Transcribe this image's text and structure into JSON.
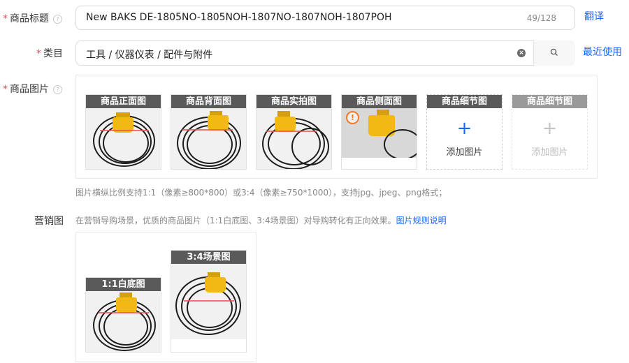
{
  "title_field": {
    "label": "商品标题",
    "value": "New BAKS DE-1805NO-1805NOH-1807NO-1807NOH-1807POH",
    "counter": "49/128",
    "action": "翻译"
  },
  "category_field": {
    "label": "类目",
    "value": "工具 / 仪器仪表 / 配件与附件",
    "action": "最近使用",
    "search_icon": "search-icon",
    "clear_icon": "clear-icon"
  },
  "images_field": {
    "label": "商品图片",
    "slots": [
      {
        "title": "商品正面图",
        "has_image": true
      },
      {
        "title": "商品背面图",
        "has_image": true
      },
      {
        "title": "商品实拍图",
        "has_image": true
      },
      {
        "title": "商品侧面图",
        "has_image": true,
        "warning": true
      },
      {
        "title": "商品细节图",
        "has_image": false,
        "add_label": "添加图片",
        "enabled": true
      },
      {
        "title": "商品细节图",
        "has_image": false,
        "add_label": "添加图片",
        "enabled": false
      }
    ],
    "hint": "图片横纵比例支持1:1（像素≥800*800）或3:4（像素≥750*1000），支持jpg、jpeg、png格式；"
  },
  "marketing_field": {
    "label": "营销图",
    "desc": "在营销导购场景，优质的商品图片（1:1白底图、3:4场景图）对导购转化有正向效果。",
    "link": "图片规则说明",
    "items": [
      {
        "title": "1:1白底图"
      },
      {
        "title": "3:4场景图"
      }
    ]
  },
  "colors": {
    "required": "#e34d59",
    "link": "#1966ff",
    "slot_header": "#5a5a5a",
    "add_plus": "#1966ff",
    "warning": "#f07b2e"
  }
}
